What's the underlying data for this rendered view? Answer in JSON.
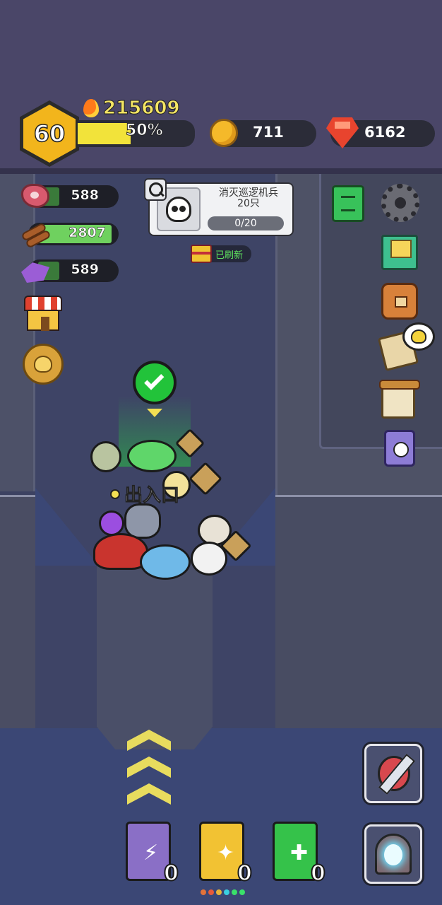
{
  "player": {
    "level": "60",
    "power": "215609",
    "xp_percent_label": "50%",
    "xp_fraction": 0.5
  },
  "currencies": {
    "coins": "711",
    "gems": "6162"
  },
  "stock": {
    "meat": "588",
    "wood": "2807",
    "ore": "589"
  },
  "quest": {
    "title_line1": "消灭巡逻机兵",
    "title_line2": "20只",
    "progress": "0/20"
  },
  "refresh_badge": "已刷新",
  "entrance_label": "出入口",
  "skills": [
    {
      "name": "lightning-book",
      "count": "0",
      "color": "#8a6fc6",
      "symbol": "⚡"
    },
    {
      "name": "wing-book",
      "count": "0",
      "color": "#f2c233",
      "symbol": "✦"
    },
    {
      "name": "heal-book",
      "count": "0",
      "color": "#35c24a",
      "symbol": "✚"
    }
  ],
  "colors": {
    "xp_bar": "#f2e33a",
    "meat_bar": "#3a7a3a",
    "wood_bar": "#6fd15f",
    "ore_bar": "#3a7a3a",
    "check": "#22c33a",
    "accent_yellow": "#f3e053"
  },
  "icons": [
    "fire-icon",
    "coin-icon",
    "gem-icon",
    "meat-icon",
    "wood-icon",
    "ore-icon",
    "shop-icon",
    "medal-icon",
    "search-icon",
    "skull-icon",
    "chest-icon",
    "book-icon",
    "gear-icon",
    "mail-icon",
    "bag-icon",
    "map-icon",
    "scroll-icon",
    "potion-icon",
    "check-icon",
    "sword-icon",
    "portal-icon"
  ]
}
